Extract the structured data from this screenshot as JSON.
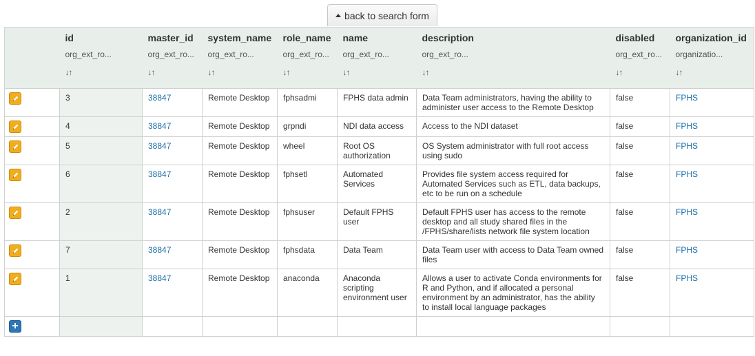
{
  "back_button": {
    "label": "back to search form"
  },
  "columns": [
    {
      "key": "id",
      "label": "id",
      "filter": "org_ext_ro..."
    },
    {
      "key": "master_id",
      "label": "master_id",
      "filter": "org_ext_ro..."
    },
    {
      "key": "system_name",
      "label": "system_name",
      "filter": "org_ext_ro..."
    },
    {
      "key": "role_name",
      "label": "role_name",
      "filter": "org_ext_ro..."
    },
    {
      "key": "name",
      "label": "name",
      "filter": "org_ext_ro..."
    },
    {
      "key": "description",
      "label": "description",
      "filter": "org_ext_ro..."
    },
    {
      "key": "disabled",
      "label": "disabled",
      "filter": "org_ext_ro..."
    },
    {
      "key": "organization_id",
      "label": "organization_id",
      "filter": "organizatio..."
    }
  ],
  "sort_glyph": "↓↑",
  "rows": [
    {
      "id": "3",
      "master_id": "38847",
      "system_name": "Remote Desktop",
      "role_name": "fphsadmi",
      "name": "FPHS data admin",
      "description": "Data Team administrators, having the ability to administer user access to the Remote Desktop",
      "disabled": "false",
      "organization_id": "FPHS"
    },
    {
      "id": "4",
      "master_id": "38847",
      "system_name": "Remote Desktop",
      "role_name": "grpndi",
      "name": "NDI data access",
      "description": "Access to the NDI dataset",
      "disabled": "false",
      "organization_id": "FPHS"
    },
    {
      "id": "5",
      "master_id": "38847",
      "system_name": "Remote Desktop",
      "role_name": "wheel",
      "name": "Root OS authorization",
      "description": "OS System administrator with full root access using sudo",
      "disabled": "false",
      "organization_id": "FPHS"
    },
    {
      "id": "6",
      "master_id": "38847",
      "system_name": "Remote Desktop",
      "role_name": "fphsetl",
      "name": "Automated Services",
      "description": "Provides file system access required for Automated Services such as ETL, data backups, etc to be run on a schedule",
      "disabled": "false",
      "organization_id": "FPHS"
    },
    {
      "id": "2",
      "master_id": "38847",
      "system_name": "Remote Desktop",
      "role_name": "fphsuser",
      "name": "Default FPHS user",
      "description": "Default FPHS user has access to the remote desktop and all study shared files in the /FPHS/share/lists network file system location",
      "disabled": "false",
      "organization_id": "FPHS"
    },
    {
      "id": "7",
      "master_id": "38847",
      "system_name": "Remote Desktop",
      "role_name": "fphsdata",
      "name": "Data Team",
      "description": "Data Team user with access to Data Team owned files",
      "disabled": "false",
      "organization_id": "FPHS"
    },
    {
      "id": "1",
      "master_id": "38847",
      "system_name": "Remote Desktop",
      "role_name": "anaconda",
      "name": "Anaconda scripting environment user",
      "description": "Allows a user to activate Conda environments for R and Python, and if allocated a personal environment by an administrator, has the ability to install local language packages",
      "disabled": "false",
      "organization_id": "FPHS"
    }
  ],
  "add_button": {
    "glyph": "+"
  },
  "colors": {
    "edit": "#f0ad1e",
    "add": "#2f76b5",
    "link": "#1a6ea8",
    "header_bg": "#e8eeea"
  }
}
